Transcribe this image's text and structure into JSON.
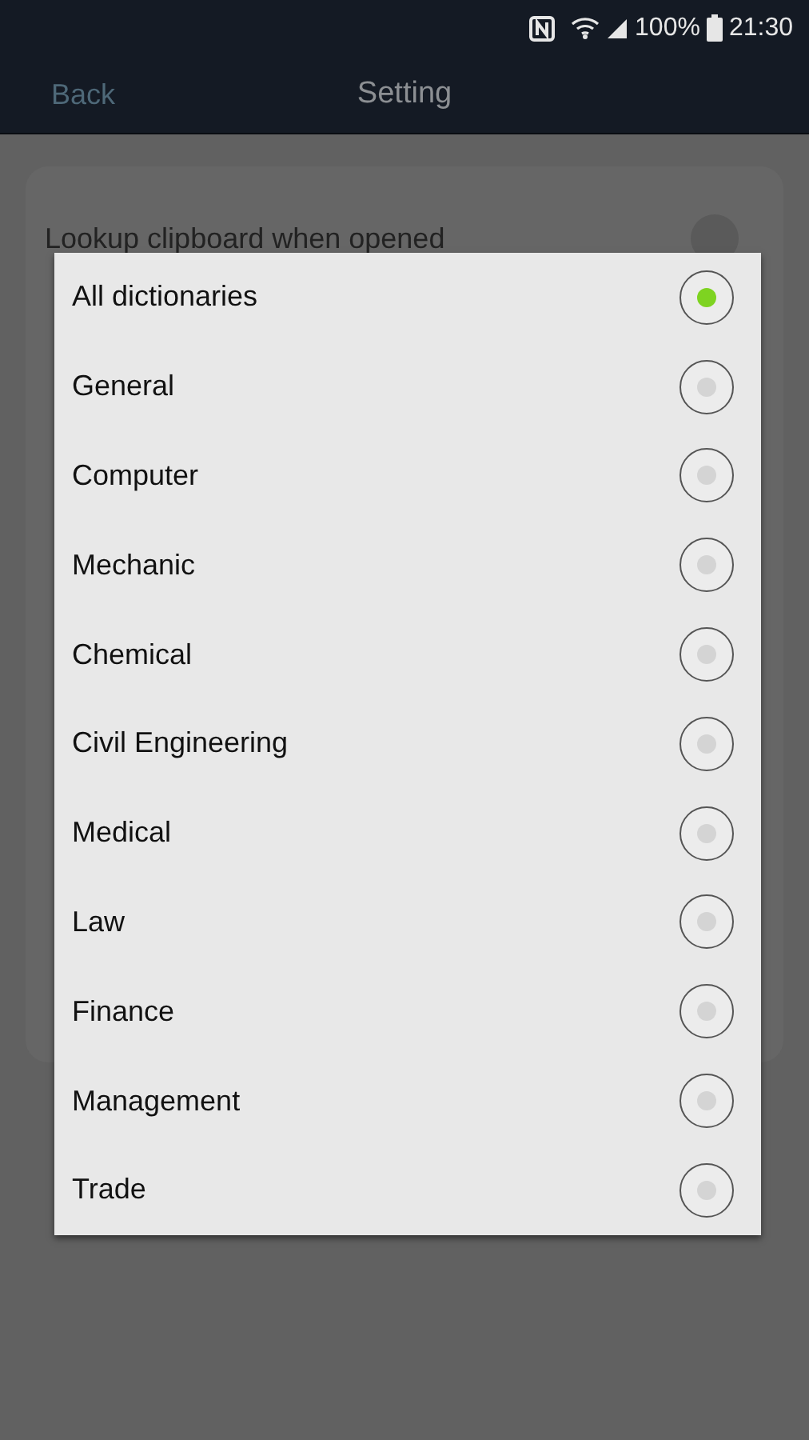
{
  "status_bar": {
    "battery": "100%",
    "time": "21:30"
  },
  "header": {
    "back": "Back",
    "title": "Setting"
  },
  "background_setting": {
    "label": "Lookup clipboard when opened",
    "on": false
  },
  "dialog": {
    "options": [
      {
        "label": "All dictionaries",
        "selected": true
      },
      {
        "label": "General",
        "selected": false
      },
      {
        "label": "Computer",
        "selected": false
      },
      {
        "label": "Mechanic",
        "selected": false
      },
      {
        "label": "Chemical",
        "selected": false
      },
      {
        "label": "Civil Engineering",
        "selected": false
      },
      {
        "label": "Medical",
        "selected": false
      },
      {
        "label": "Law",
        "selected": false
      },
      {
        "label": "Finance",
        "selected": false
      },
      {
        "label": "Management",
        "selected": false
      },
      {
        "label": "Trade",
        "selected": false
      }
    ]
  }
}
